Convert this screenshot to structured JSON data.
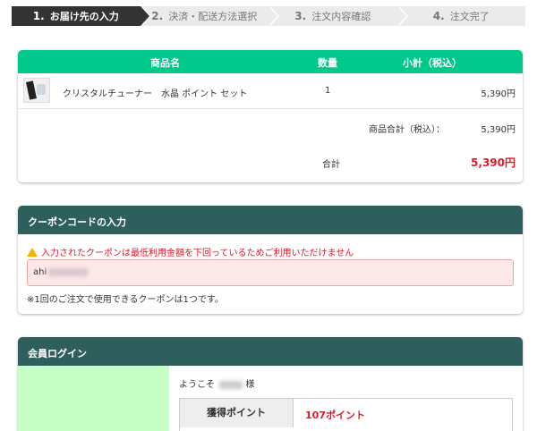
{
  "steps": [
    {
      "num": "1.",
      "label": "お届け先の入力"
    },
    {
      "num": "2.",
      "label": "決済・配送方法選択"
    },
    {
      "num": "3.",
      "label": "注文内容確認"
    },
    {
      "num": "4.",
      "label": "注文完了"
    }
  ],
  "cart": {
    "headers": {
      "name": "商品名",
      "qty": "数量",
      "subtotal": "小計（税込）"
    },
    "item": {
      "name": "クリスタルチューナー　水晶 ポイント セット",
      "qty": "1",
      "subtotal": "5,390円"
    },
    "goods_total_label": "商品合計（税込）：",
    "goods_total_value": "5,390円",
    "total_label": "合計",
    "total_value": "5,390円"
  },
  "coupon": {
    "title": "クーポンコードの入力",
    "warning": "入力されたクーポンは最低利用金額を下回っているためご利用いただけません",
    "input_value": "ahi",
    "note": "※1回のご注文で使用できるクーポンは1つです。"
  },
  "member": {
    "title": "会員ログイン",
    "welcome_prefix": "ようこそ",
    "welcome_suffix": "様",
    "points_label": "獲得ポイント",
    "points_value": "107ポイント"
  },
  "colors": {
    "accent": "#00c98b",
    "dark_header": "#2f5f5d",
    "price_red": "#e0182b",
    "login_green": "#c8ffc6"
  },
  "icons": {
    "warning": "warning-triangle-icon"
  }
}
